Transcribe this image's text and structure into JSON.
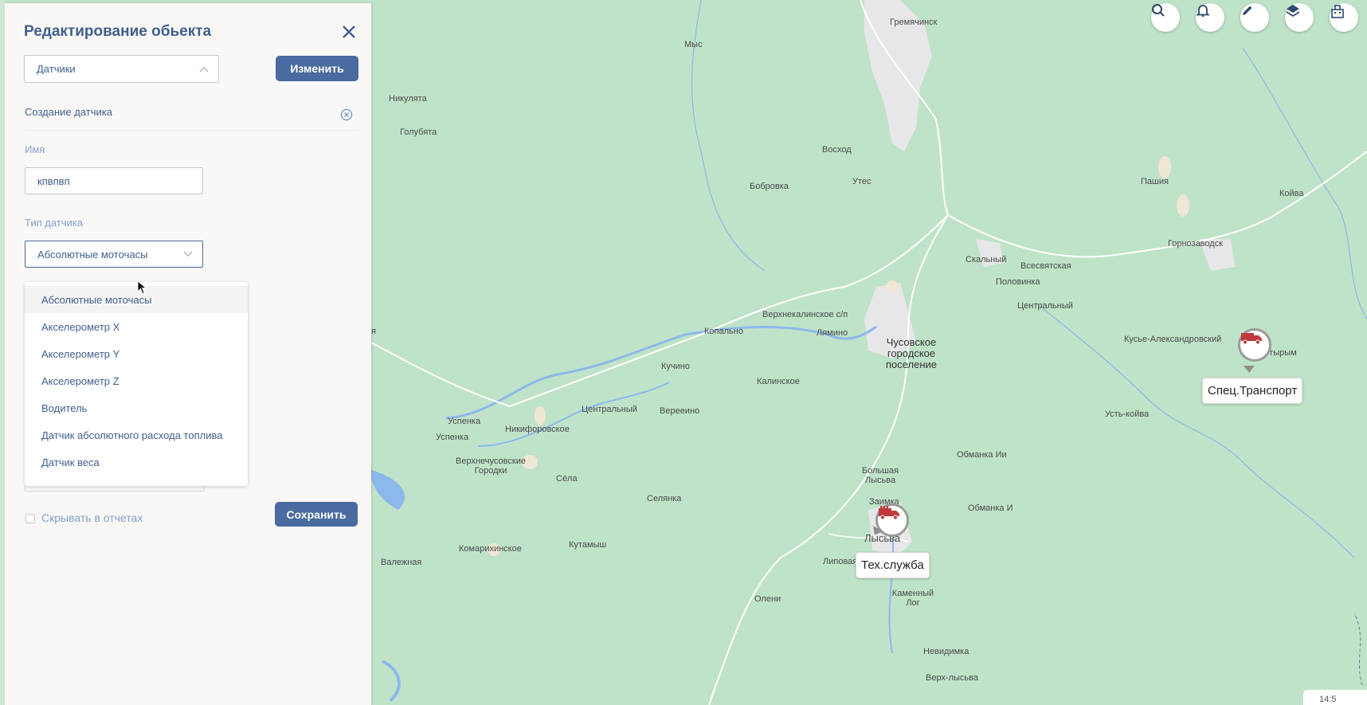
{
  "panel": {
    "title": "Редактирование обьекта",
    "section_select": "Датчики",
    "edit_button": "Изменить",
    "subsection_title": "Создание датчика",
    "name_label": "Имя",
    "name_value": "кпвпвп",
    "type_label": "Тип датчика",
    "type_value": "Абсолютные моточасы",
    "dropdown_items": [
      "Абсолютные моточасы",
      "Акселерометр X",
      "Акселерометр Y",
      "Акселерометр Z",
      "Водитель",
      "Датчик абсолютного расхода топлива",
      "Датчик веса"
    ],
    "help_mark": "?",
    "hide_in_reports_label": "Скрывать в отчетах",
    "save_button": "Сохранить"
  },
  "map": {
    "places": [
      "Гремячинск",
      "Мыс",
      "Никулята",
      "Голубята",
      "Восход",
      "Бобровка",
      "Утес",
      "Пашия",
      "Койва",
      "Горнозаводск",
      "Скальный",
      "Всесвятская",
      "Половинка",
      "Центральный",
      "Верхнекалинское с/п",
      "Лямино",
      "Копально",
      "Кучино",
      "Калинское",
      "Центральный",
      "Верееино",
      "Успенка",
      "Успенка",
      "Никифоровское",
      "Верхнечусовские Городки",
      "Сёла",
      "Селянка",
      "Комарихинское",
      "Кутамыш",
      "Валежная",
      "Большая Лысьва",
      "Заимка",
      "Лысьва",
      "Липовая",
      "Олени",
      "Каменный Лог",
      "Невидимка",
      "Верх-лысьва",
      "Обманка Ии",
      "Обманка И",
      "Усть-койва",
      "Кусье-Александровский",
      "Усть-тырым",
      "я"
    ],
    "city_label": "Чусовское городское поселение",
    "vehicles": [
      {
        "label": "Спец.Транспорт",
        "icon": "truck-icon"
      },
      {
        "label": "Тех.служба",
        "icon": "service-truck-icon"
      }
    ],
    "clock": "14:5"
  },
  "toolbar": [
    "search-icon",
    "bell-icon",
    "pencil-icon",
    "layers-icon",
    "building-icon"
  ],
  "colors": {
    "accent": "#4a6ba0",
    "title": "#3f5f8f",
    "label": "#7f9fcf",
    "map_bg": "#bfe3c8",
    "water": "#8cb8ec",
    "vehicle_red": "#c0393b"
  }
}
